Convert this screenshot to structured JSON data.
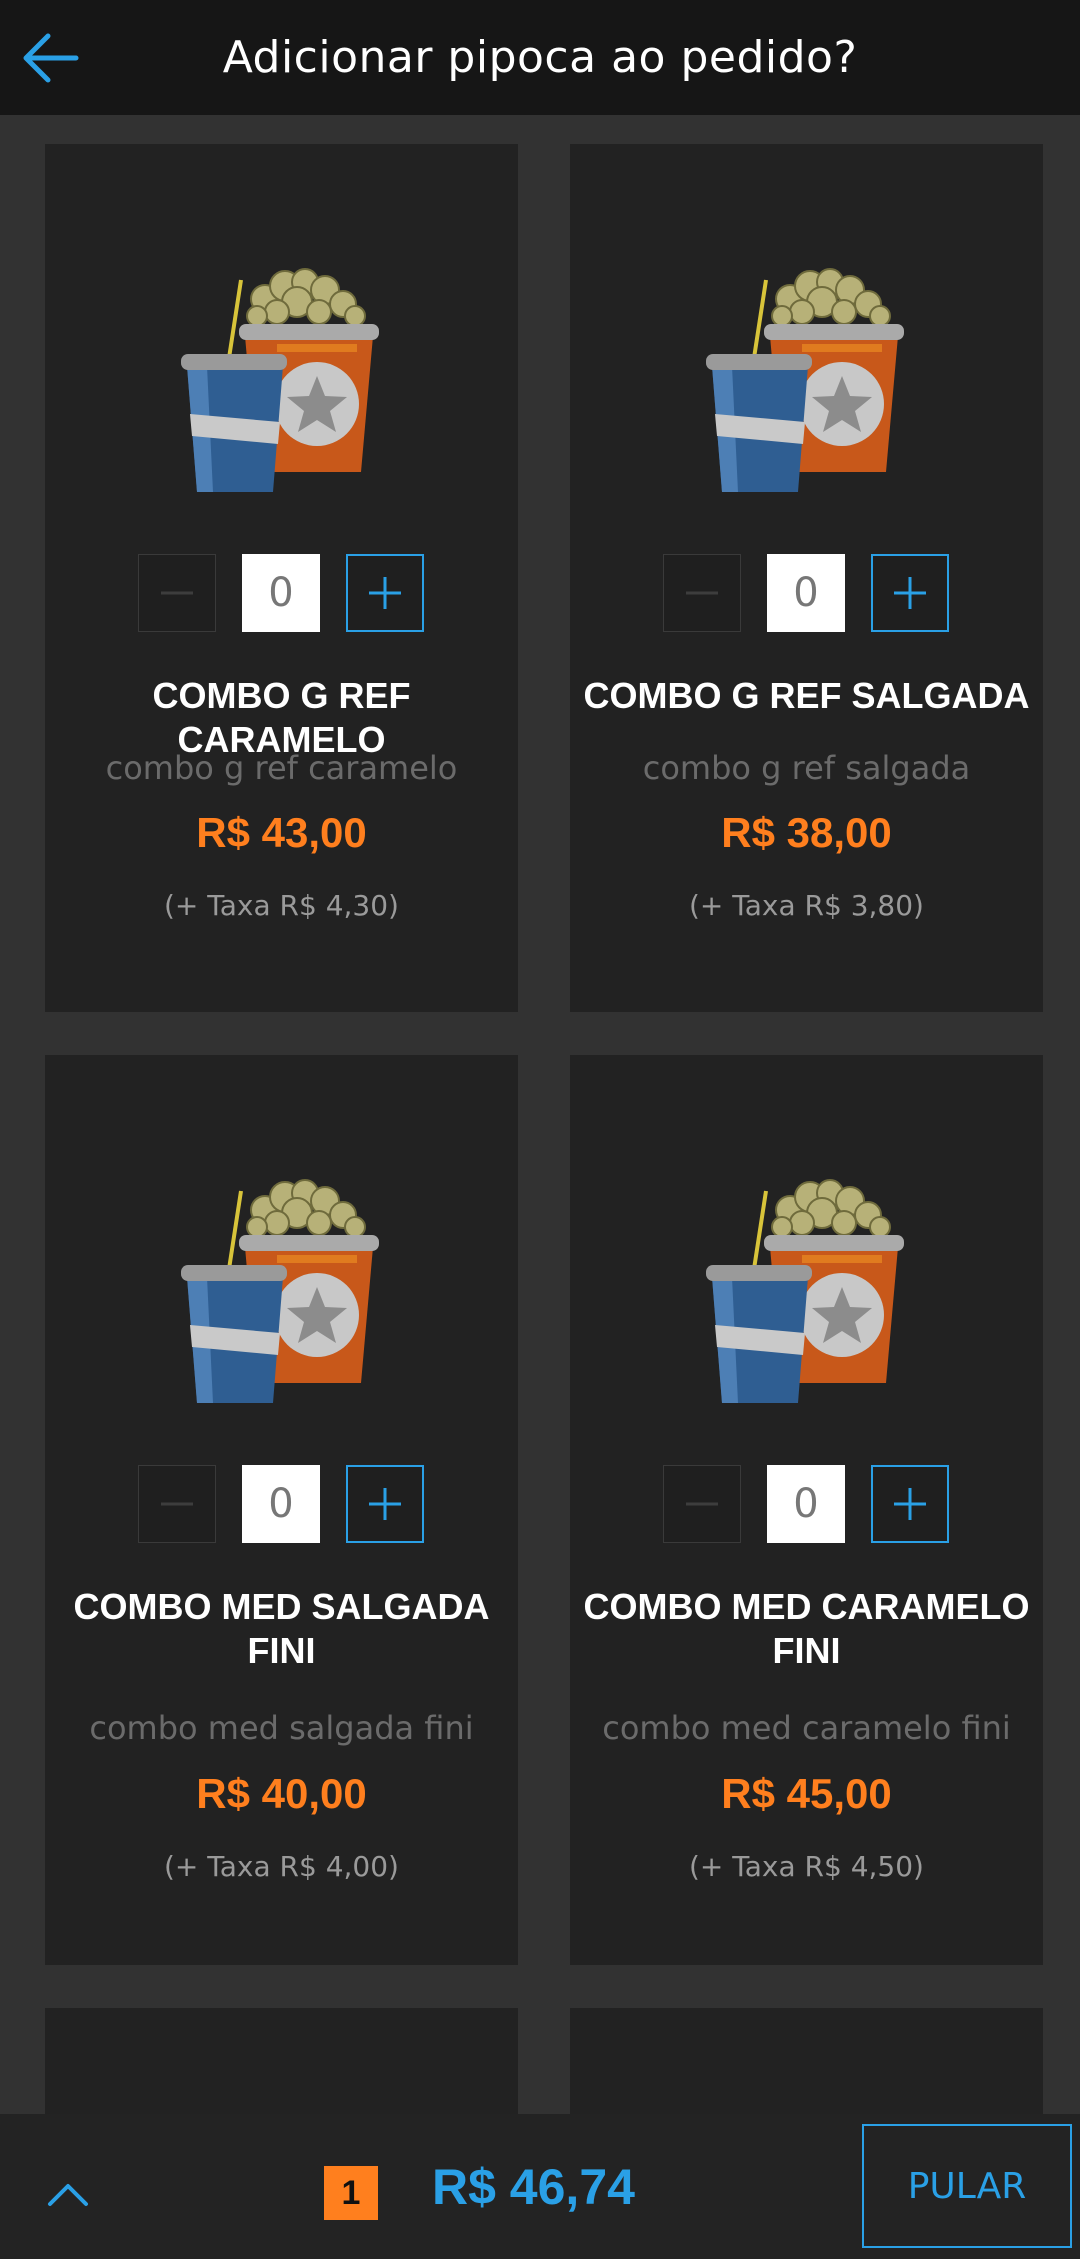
{
  "header": {
    "title": "Adicionar pipoca ao pedido?"
  },
  "products": [
    {
      "name": "COMBO G REF CARAMELO",
      "description": "combo g ref caramelo",
      "price": "R$ 43,00",
      "fee": "(+ Taxa R$ 4,30)",
      "quantity": "0"
    },
    {
      "name": "COMBO G REF SALGADA",
      "description": "combo g ref salgada",
      "price": "R$ 38,00",
      "fee": "(+ Taxa R$ 3,80)",
      "quantity": "0"
    },
    {
      "name": "COMBO MED SALGADA FINI",
      "description": "combo med salgada fini",
      "price": "R$ 40,00",
      "fee": "(+ Taxa R$ 4,00)",
      "quantity": "0"
    },
    {
      "name": "COMBO MED CARAMELO FINI",
      "description": "combo med caramelo fini",
      "price": "R$ 45,00",
      "fee": "(+ Taxa R$ 4,50)",
      "quantity": "0"
    }
  ],
  "footer": {
    "item_count": "1",
    "total": "R$ 46,74",
    "skip_label": "PULAR"
  },
  "icons": {
    "back": "arrow-left-icon",
    "expand": "chevron-up-icon",
    "minus": "minus-icon",
    "plus": "plus-icon"
  },
  "colors": {
    "accent": "#2aa0e6",
    "price": "#ff7f1e",
    "card": "#222222",
    "background": "#323232"
  }
}
